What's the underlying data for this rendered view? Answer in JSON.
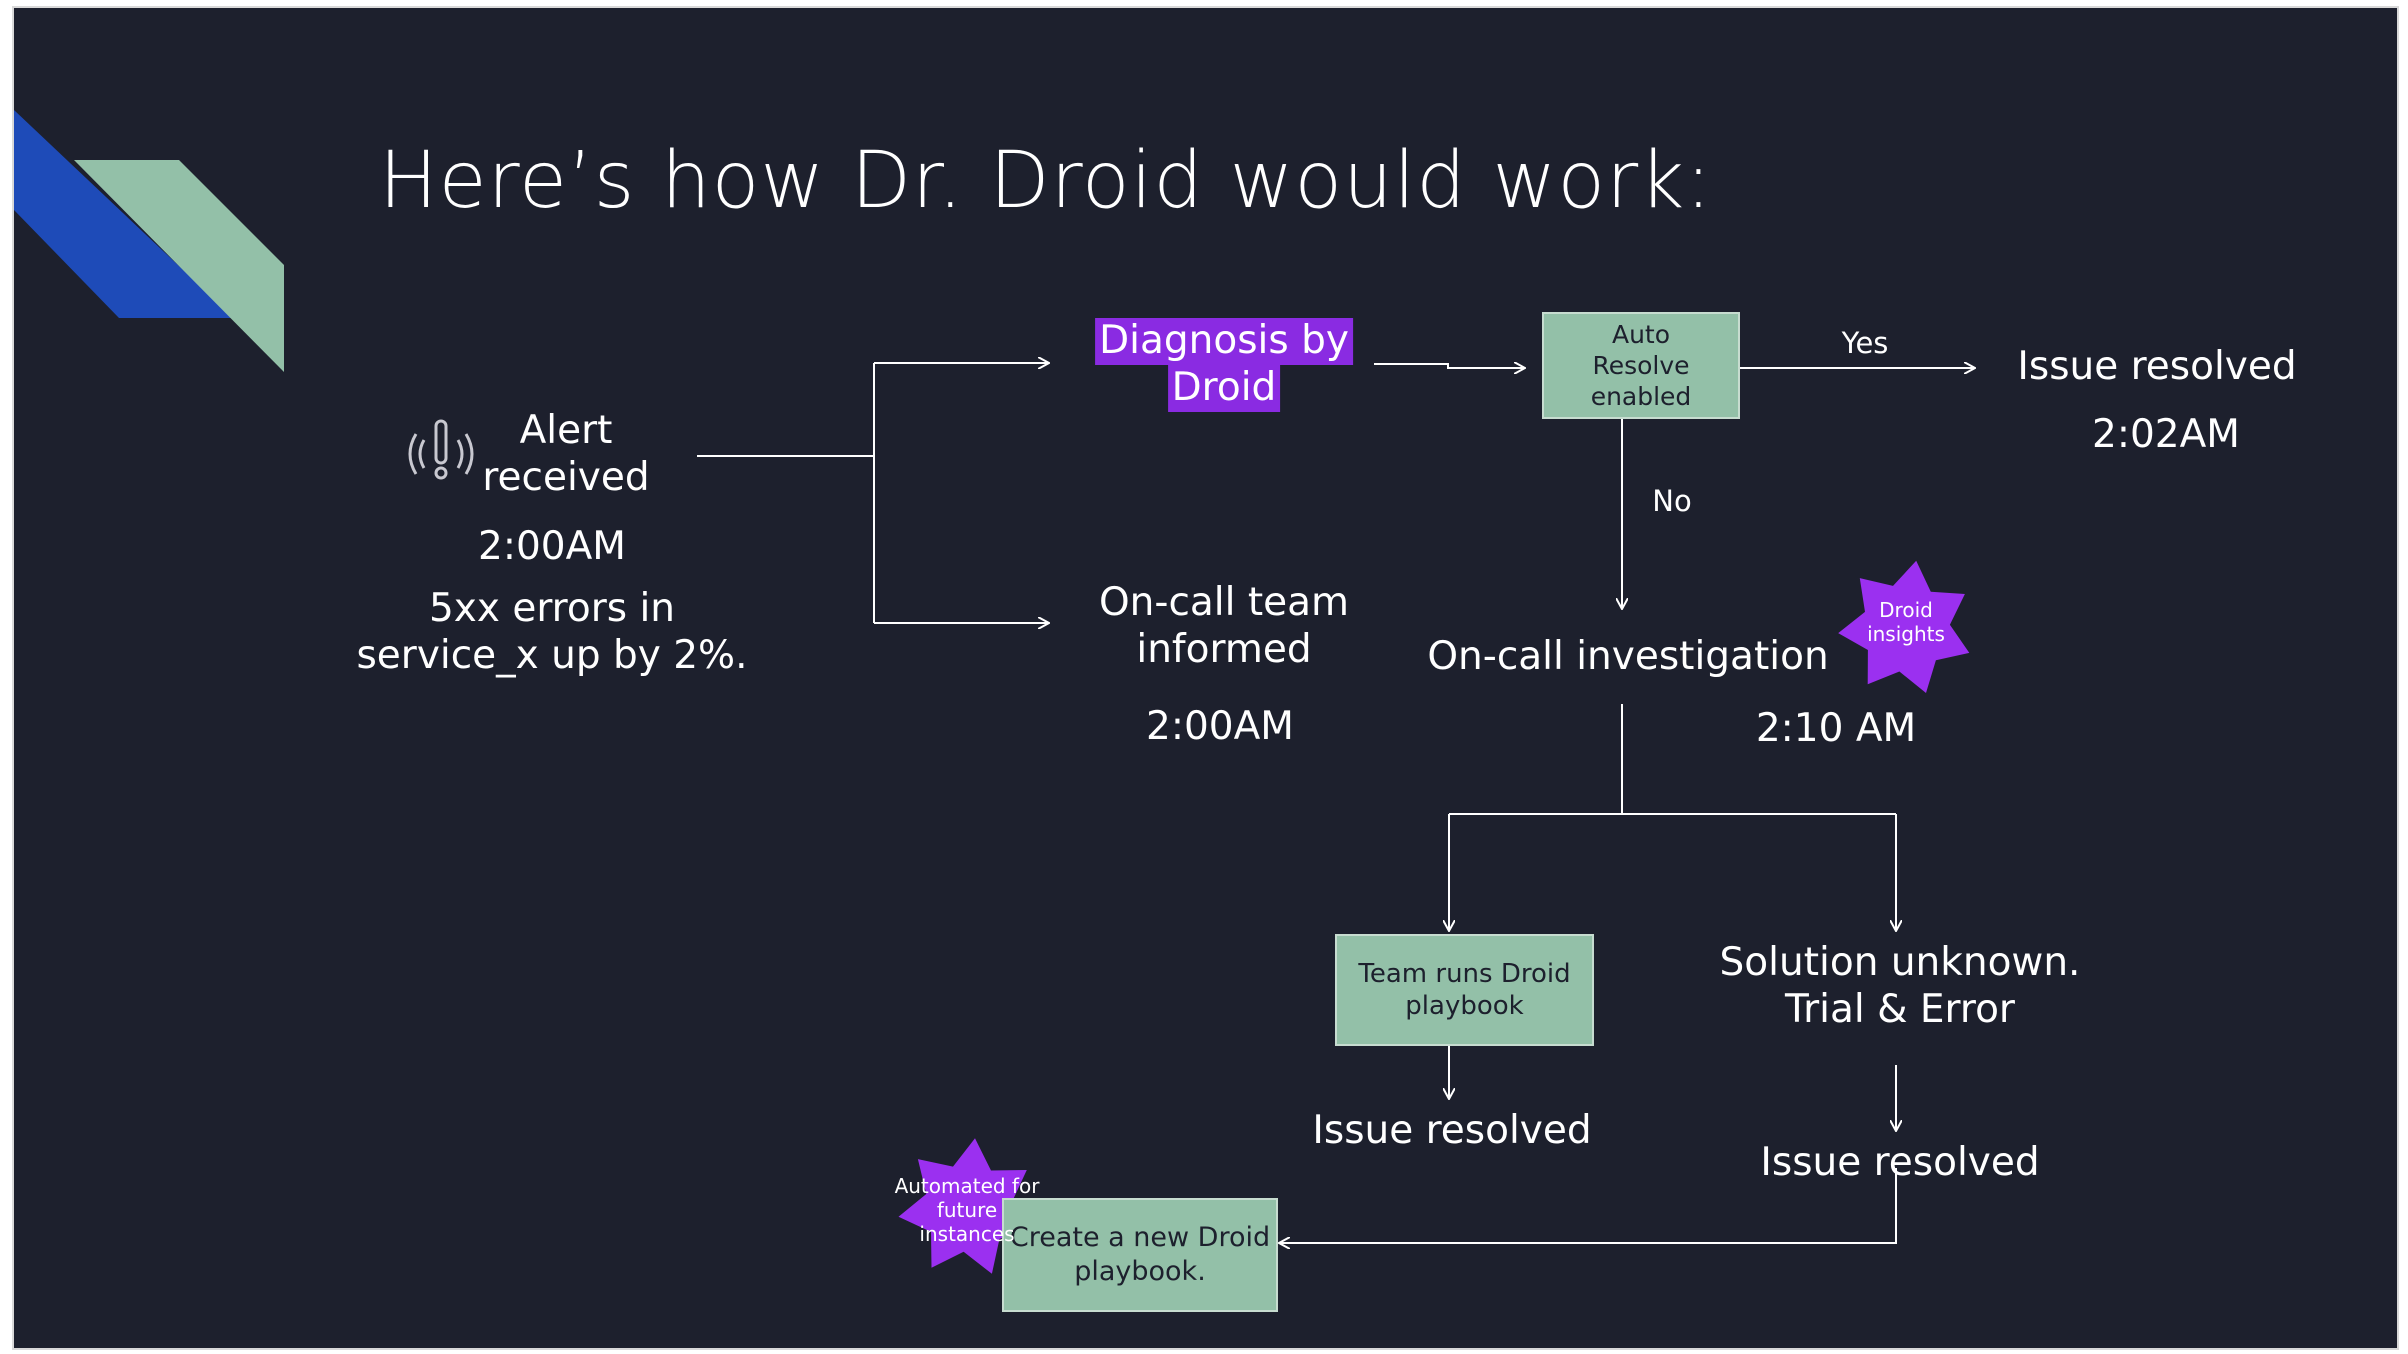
{
  "title": "Here’s how Dr. Droid would work:",
  "colors": {
    "background": "#1d202d",
    "box": "#93c0a8",
    "highlight": "#8a2be2",
    "star": "#9b30f0",
    "stripe_blue": "#1e4bb8",
    "stripe_green": "#93c0a8"
  },
  "icons": {
    "alert": "alert-signal-icon"
  },
  "nodes": {
    "alert": {
      "line1": "Alert",
      "line2": "received",
      "time": "2:00AM",
      "desc1": "5xx errors in",
      "desc2": "service_x up by 2%."
    },
    "diagnosis": {
      "line1": "Diagnosis by",
      "line2": "Droid"
    },
    "oncall_team": {
      "line1": "On-call team",
      "line2": "informed",
      "time": "2:00AM"
    },
    "auto_resolve": {
      "line1": "Auto",
      "line2": "Resolve",
      "line3": "enabled"
    },
    "yes_label": "Yes",
    "no_label": "No",
    "issue_resolved_top": {
      "label": "Issue resolved",
      "time": "2:02AM"
    },
    "oncall_investigation": {
      "label": "On-call investigation",
      "time": "2:10 AM"
    },
    "droid_insights": {
      "line1": "Droid",
      "line2": "insights"
    },
    "team_playbook": {
      "line1": "Team runs Droid",
      "line2": "playbook"
    },
    "issue_resolved_left": "Issue resolved",
    "solution_unknown": {
      "line1": "Solution unknown.",
      "line2": "Trial & Error"
    },
    "issue_resolved_right": "Issue resolved",
    "new_playbook": {
      "line1": "Create a new Droid",
      "line2": "playbook."
    },
    "automated": {
      "line1": "Automated for",
      "line2": "future",
      "line3": "instances"
    }
  }
}
